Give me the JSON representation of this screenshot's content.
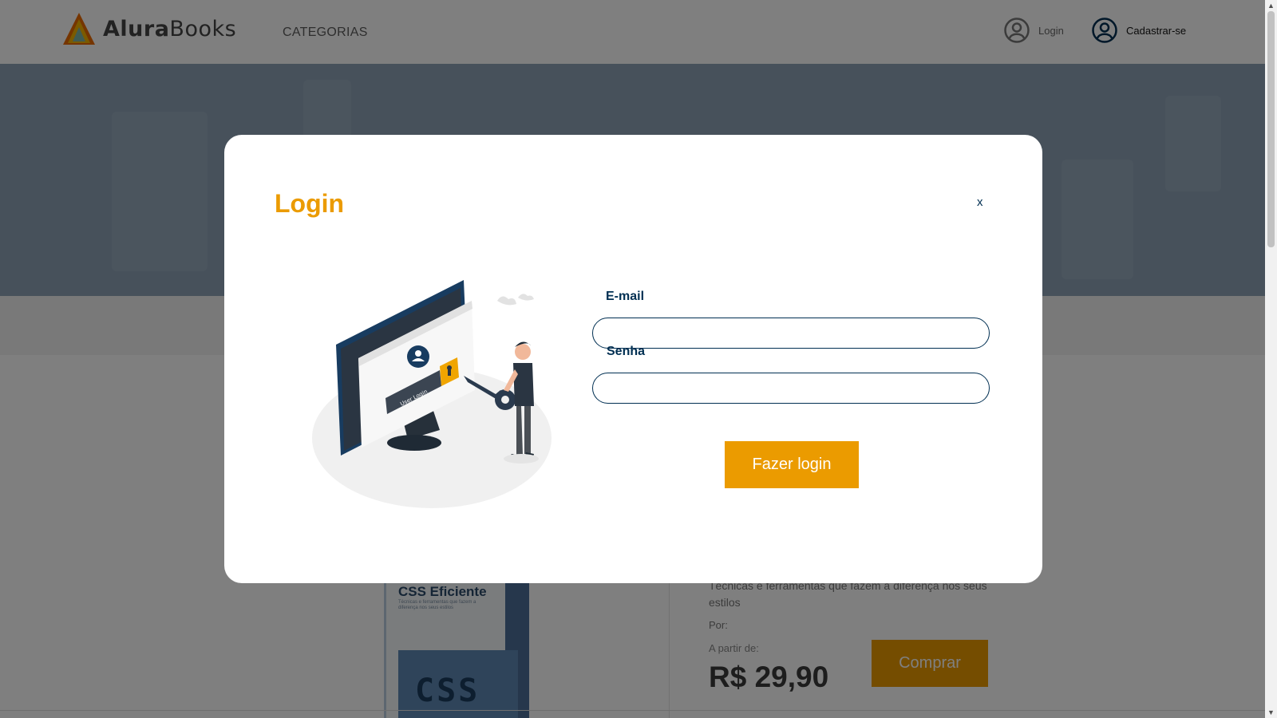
{
  "header": {
    "logo_text_bold": "Alura",
    "logo_text_light": "Books",
    "nav_categorias": "CATEGORIAS",
    "login_label": "Login",
    "cadastro_label": "Cadastrar-se"
  },
  "book": {
    "cover_title": "CSS Eficiente",
    "cover_subtitle": "Técnicas e ferramentas que fazem a diferença nos seus estilos",
    "cover_css_text": "CSS",
    "description": "Técnicas e ferramentas que fazem a diferença nos seus estilos",
    "por_label": "Por:",
    "a_partir_label": "A partir de:",
    "price": "R$ 29,90",
    "buy_label": "Comprar"
  },
  "modal": {
    "title": "Login",
    "close_label": "x",
    "email_label": "E-mail",
    "email_value": "",
    "senha_label": "Senha",
    "senha_value": "",
    "submit_label": "Fazer login",
    "illustration_text": "User Login"
  },
  "colors": {
    "accent": "#eb9b00",
    "navy": "#002f52",
    "overlay": "rgba(0,0,0,0.5)"
  }
}
